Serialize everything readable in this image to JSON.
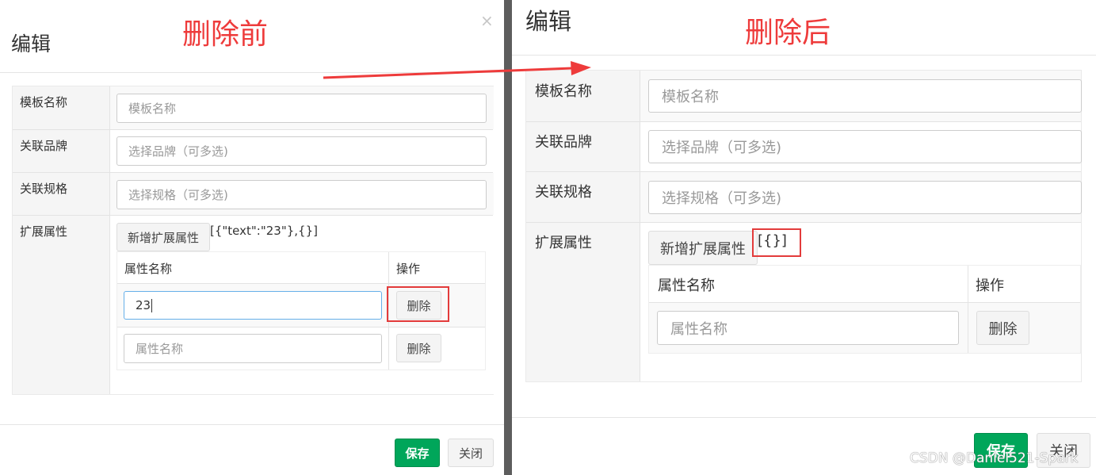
{
  "annotations": {
    "before": "删除前",
    "after": "删除后",
    "watermark": "CSDN @Daniel521-Spark"
  },
  "colors": {
    "annotation_red": "#ee3b3b",
    "save_green": "#00a65a",
    "divider": "#5d5d5d"
  },
  "before_dialog": {
    "title": "编辑",
    "close_icon": "close-icon",
    "fields": {
      "template_name": {
        "label": "模板名称",
        "placeholder": "模板名称"
      },
      "brand": {
        "label": "关联品牌",
        "placeholder": "选择品牌（可多选)"
      },
      "spec": {
        "label": "关联规格",
        "placeholder": "选择规格（可多选)"
      },
      "ext": {
        "label": "扩展属性"
      }
    },
    "add_button": "新增扩展属性",
    "json_text": "[{\"text\":\"23\"},{}]",
    "table": {
      "headers": [
        "属性名称",
        "操作"
      ],
      "rows": [
        {
          "value": "23",
          "placeholder": "属性名称",
          "delete": "删除"
        },
        {
          "value": "",
          "placeholder": "属性名称",
          "delete": "删除"
        }
      ]
    },
    "save": "保存",
    "close": "关闭"
  },
  "after_dialog": {
    "title": "编辑",
    "fields": {
      "template_name": {
        "label": "模板名称",
        "placeholder": "模板名称"
      },
      "brand": {
        "label": "关联品牌",
        "placeholder": "选择品牌（可多选)"
      },
      "spec": {
        "label": "关联规格",
        "placeholder": "选择规格（可多选)"
      },
      "ext": {
        "label": "扩展属性"
      }
    },
    "add_button": "新增扩展属性",
    "json_text": "[{}]",
    "table": {
      "headers": [
        "属性名称",
        "操作"
      ],
      "rows": [
        {
          "value": "",
          "placeholder": "属性名称",
          "delete": "删除"
        }
      ]
    },
    "save": "保存",
    "close": "关闭"
  }
}
